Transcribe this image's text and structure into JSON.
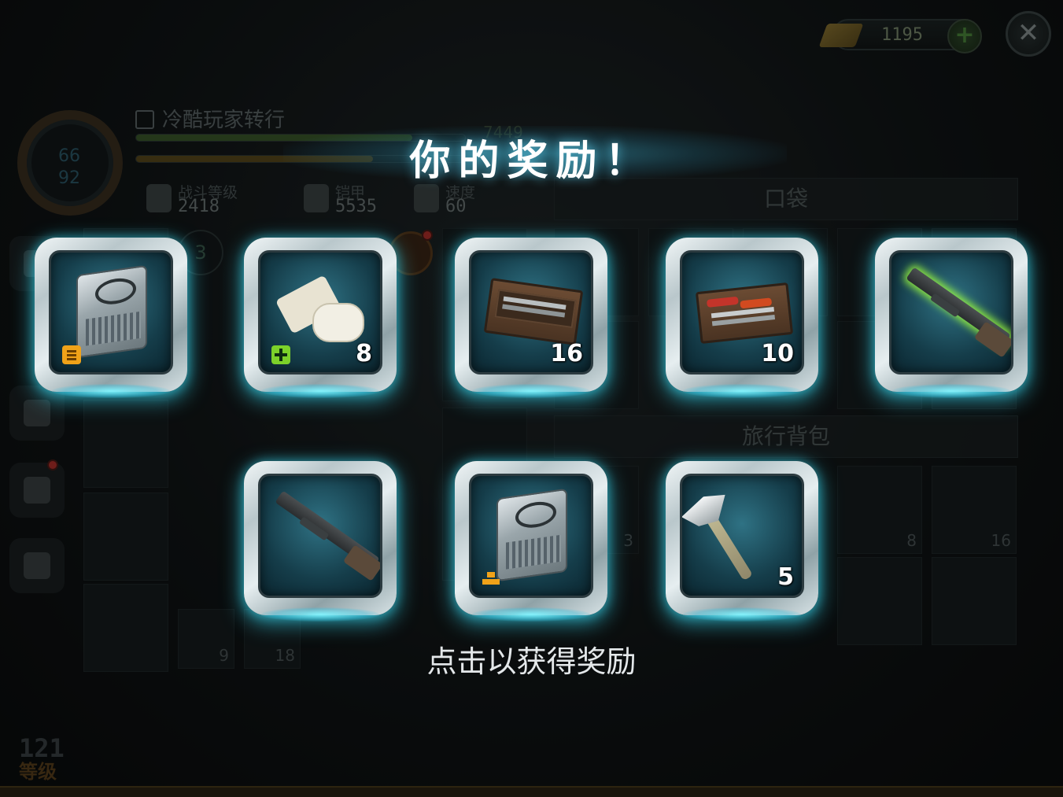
{
  "header": {
    "currency_value": "1195",
    "currency_icon": "gold-bar-icon",
    "add_icon": "plus-icon",
    "close_icon": "close-x-icon"
  },
  "profile": {
    "player_name": "冷酷玩家转行",
    "xp_value": "7449",
    "ring_values": [
      "66",
      "92"
    ],
    "stats": [
      {
        "label": "战斗等级",
        "value": "2418",
        "icon": "fist-icon"
      },
      {
        "label": "铠甲",
        "value": "5535",
        "icon": "armor-vest-icon"
      },
      {
        "label": "速度",
        "value": "60",
        "icon": "speed-boot-icon"
      }
    ],
    "level_number": "121",
    "level_label": "等级"
  },
  "inventory": {
    "pocket_header": "口袋",
    "backpack_header": "旅行背包",
    "side_badge": "3",
    "background_counts": [
      "3",
      "8",
      "16",
      "9",
      "18"
    ]
  },
  "reward": {
    "title": "你的奖励！",
    "footer": "点击以获得奖励",
    "items": [
      {
        "name": "supply-crate-armor",
        "icon": "metal-crate-icon",
        "badge": "armor",
        "count": ""
      },
      {
        "name": "bandage",
        "icon": "bandage-icon",
        "badge": "medical",
        "count": "8"
      },
      {
        "name": "toolbox",
        "icon": "toolbox-icon",
        "badge": "",
        "count": "16"
      },
      {
        "name": "tool-kit",
        "icon": "toolbox-open-icon",
        "badge": "",
        "count": "10"
      },
      {
        "name": "shotgun-rare",
        "icon": "shotgun-icon",
        "badge": "",
        "count": ""
      },
      {
        "name": "shotgun",
        "icon": "shotgun-icon",
        "badge": "",
        "count": ""
      },
      {
        "name": "supply-crate-gold",
        "icon": "metal-crate-icon",
        "badge": "gold",
        "count": ""
      },
      {
        "name": "hatchet",
        "icon": "hatchet-icon",
        "badge": "",
        "count": "5"
      }
    ]
  },
  "colors": {
    "accent_glow": "#3ce6ff",
    "badge_armor": "#f0a219",
    "badge_medical": "#7cd12a",
    "rare_glow": "#a0ff3c"
  }
}
